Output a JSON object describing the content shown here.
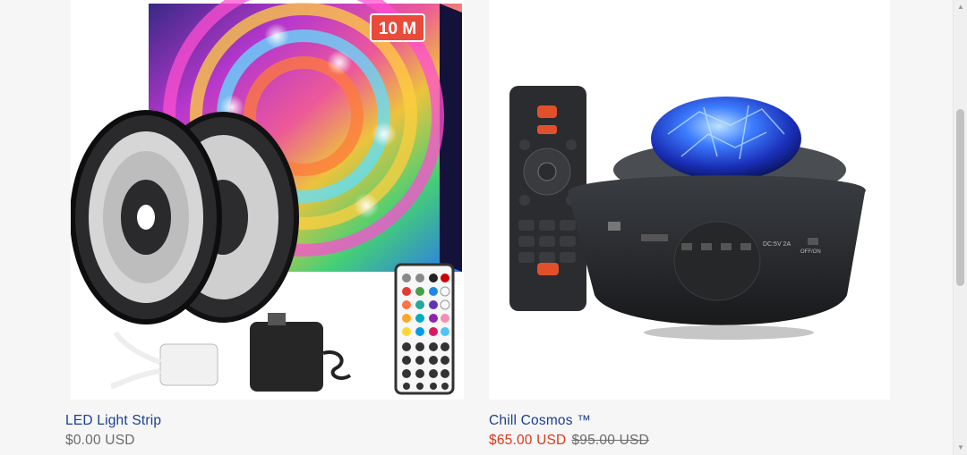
{
  "products": [
    {
      "title": "LED Light Strip",
      "price": "$0.00 USD",
      "image": {
        "badge": "10 M"
      }
    },
    {
      "title": "Chill Cosmos ™",
      "sale_price": "$65.00 USD",
      "compare_price": "$95.00 USD",
      "image": {
        "port_label": "DC:5V 2A",
        "switch_label": "OFF/ON"
      }
    }
  ],
  "scrollbar": {
    "up_icon": "▲",
    "down_icon": "▼"
  }
}
